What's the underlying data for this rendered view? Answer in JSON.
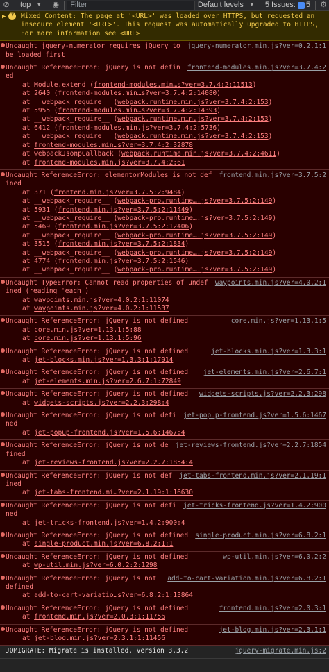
{
  "toolbar": {
    "context": "top",
    "filter_placeholder": "Filter",
    "levels": "Default levels",
    "issues_label": "5 Issues:",
    "issues_count": "5"
  },
  "messages": [
    {
      "level": "warn",
      "badge": "7",
      "text": "Mixed Content: The page at '<URL>' was loaded over HTTPS, but requested an insecure element '<URL>'. This request was automatically upgraded to HTTPS, For more information see <URL>",
      "source": "",
      "frames": []
    },
    {
      "level": "error",
      "text": "Uncaught jquery-numerator requires jQuery to be loaded first",
      "source": "jquery-numerator.min.js?ver=0.2.1:1",
      "frames": []
    },
    {
      "level": "error",
      "text": "Uncaught ReferenceError: jQuery is not defined",
      "source": "frontend-modules.min.js?ver=3.7.4:2",
      "frames": [
        {
          "pre": "at Module.extend (",
          "link": "frontend-modules.min…s?ver=3.7.4:2:11513",
          "post": ")"
        },
        {
          "pre": "at 2640 (",
          "link": "frontend-modules.min…s?ver=3.7.4:2:14080",
          "post": ")"
        },
        {
          "pre": "at __webpack_require__ (",
          "link": "webpack.runtime.min.js?ver=3.7.4:2:153",
          "post": ")"
        },
        {
          "pre": "at 5955 (",
          "link": "frontend-modules.min…s?ver=3.7.4:2:14393",
          "post": ")"
        },
        {
          "pre": "at __webpack_require__ (",
          "link": "webpack.runtime.min.js?ver=3.7.4:2:153",
          "post": ")"
        },
        {
          "pre": "at 6412 (",
          "link": "frontend-modules.min.js?ver=3.7.4:2:5736",
          "post": ")"
        },
        {
          "pre": "at __webpack_require__ (",
          "link": "webpack.runtime.min.js?ver=3.7.4:2:153",
          "post": ")"
        },
        {
          "pre": "at ",
          "link": "frontend-modules.min…s?ver=3.7.4:2:32878",
          "post": ""
        },
        {
          "pre": "at webpackJsonpCallback (",
          "link": "webpack.runtime.min.js?ver=3.7.4:2:4611",
          "post": ")"
        },
        {
          "pre": "at ",
          "link": "frontend-modules.min.js?ver=3.7.4:2:61",
          "post": ""
        }
      ]
    },
    {
      "level": "error",
      "text": "Uncaught ReferenceError: elementorModules is not defined",
      "source": "frontend.min.js?ver=3.7.5:2",
      "frames": [
        {
          "pre": "at 371 (",
          "link": "frontend.min.js?ver=3.7.5:2:9484",
          "post": ")"
        },
        {
          "pre": "at __webpack_require__ (",
          "link": "webpack-pro.runtime….js?ver=3.7.5:2:149",
          "post": ")"
        },
        {
          "pre": "at 5931 (",
          "link": "frontend.min.js?ver=3.7.5:2:11449",
          "post": ")"
        },
        {
          "pre": "at __webpack_require__ (",
          "link": "webpack-pro.runtime….js?ver=3.7.5:2:149",
          "post": ")"
        },
        {
          "pre": "at 5469 (",
          "link": "frontend.min.js?ver=3.7.5:2:12406",
          "post": ")"
        },
        {
          "pre": "at __webpack_require__ (",
          "link": "webpack-pro.runtime….js?ver=3.7.5:2:149",
          "post": ")"
        },
        {
          "pre": "at 3515 (",
          "link": "frontend.min.js?ver=3.7.5:2:1834",
          "post": ")"
        },
        {
          "pre": "at __webpack_require__ (",
          "link": "webpack-pro.runtime….js?ver=3.7.5:2:149",
          "post": ")"
        },
        {
          "pre": "at 4774 (",
          "link": "frontend.min.js?ver=3.7.5:2:1546",
          "post": ")"
        },
        {
          "pre": "at __webpack_require__ (",
          "link": "webpack-pro.runtime….js?ver=3.7.5:2:149",
          "post": ")"
        }
      ]
    },
    {
      "level": "error",
      "text": "Uncaught TypeError: Cannot read properties of undefined (reading 'each')",
      "source": "waypoints.min.js?ver=4.0.2:1",
      "frames": [
        {
          "pre": "at ",
          "link": "waypoints.min.js?ver=4.0.2:1:11074",
          "post": ""
        },
        {
          "pre": "at ",
          "link": "waypoints.min.js?ver=4.0.2:1:11537",
          "post": ""
        }
      ]
    },
    {
      "level": "error",
      "text": "Uncaught ReferenceError: jQuery is not defined",
      "source": "core.min.js?ver=1.13.1:5",
      "frames": [
        {
          "pre": "at ",
          "link": "core.min.js?ver=1.13.1:5:88",
          "post": ""
        },
        {
          "pre": "at ",
          "link": "core.min.js?ver=1.13.1:5:96",
          "post": ""
        }
      ]
    },
    {
      "level": "error",
      "text": "Uncaught ReferenceError: jQuery is not defined",
      "source": "jet-blocks.min.js?ver=1.3.3:1",
      "frames": [
        {
          "pre": "at ",
          "link": "jet-blocks.min.js?ver=1.3.3:1:17914",
          "post": ""
        }
      ]
    },
    {
      "level": "error",
      "text": "Uncaught ReferenceError: jQuery is not defined",
      "source": "jet-elements.min.js?ver=2.6.7:1",
      "frames": [
        {
          "pre": "at ",
          "link": "jet-elements.min.js?ver=2.6.7:1:72849",
          "post": ""
        }
      ]
    },
    {
      "level": "error",
      "text": "Uncaught ReferenceError: jQuery is not defined",
      "source": "widgets-scripts.js?ver=2.2.3:298",
      "frames": [
        {
          "pre": "at ",
          "link": "widgets-scripts.js?ver=2.2.3:298:4",
          "post": ""
        }
      ]
    },
    {
      "level": "error",
      "text": "Uncaught ReferenceError: jQuery is not defined",
      "source": "jet-popup-frontend.js?ver=1.5.6:1467",
      "frames": [
        {
          "pre": "at ",
          "link": "jet-popup-frontend.js?ver=1.5.6:1467:4",
          "post": ""
        }
      ]
    },
    {
      "level": "error",
      "text": "Uncaught ReferenceError: jQuery is not defined",
      "source": "jet-reviews-frontend.js?ver=2.2.7:1854",
      "frames": [
        {
          "pre": "at ",
          "link": "jet-reviews-frontend.js?ver=2.2.7:1854:4",
          "post": ""
        }
      ]
    },
    {
      "level": "error",
      "text": "Uncaught ReferenceError: jQuery is not defined",
      "source": "jet-tabs-frontend.min.js?ver=2.1.19:1",
      "frames": [
        {
          "pre": "at ",
          "link": "jet-tabs-frontend.mi…?ver=2.1.19:1:16630",
          "post": ""
        }
      ]
    },
    {
      "level": "error",
      "text": "Uncaught ReferenceError: jQuery is not defined",
      "source": "jet-tricks-frontend.js?ver=1.4.2:900",
      "frames": [
        {
          "pre": "at ",
          "link": "jet-tricks-frontend.js?ver=1.4.2:900:4",
          "post": ""
        }
      ]
    },
    {
      "level": "error",
      "text": "Uncaught ReferenceError: jQuery is not defined",
      "source": "single-product.min.js?ver=6.8.2:1",
      "frames": [
        {
          "pre": "at ",
          "link": "single-product.min.js?ver=6.8.2:1:1",
          "post": ""
        }
      ]
    },
    {
      "level": "error",
      "text": "Uncaught ReferenceError: jQuery is not defined",
      "source": "wp-util.min.js?ver=6.0.2:2",
      "frames": [
        {
          "pre": "at ",
          "link": "wp-util.min.js?ver=6.0.2:2:1298",
          "post": ""
        }
      ]
    },
    {
      "level": "error",
      "text": "Uncaught ReferenceError: jQuery is not defined",
      "source": "add-to-cart-variation.min.js?ver=6.8.2:1",
      "frames": [
        {
          "pre": "at ",
          "link": "add-to-cart-variatio…s?ver=6.8.2:1:13864",
          "post": ""
        }
      ]
    },
    {
      "level": "error",
      "text": "Uncaught ReferenceError: jQuery is not defined",
      "source": "frontend.min.js?ver=2.0.3:1",
      "frames": [
        {
          "pre": "at ",
          "link": "frontend.min.js?ver=2.0.3:1:11756",
          "post": ""
        }
      ]
    },
    {
      "level": "error",
      "text": "Uncaught ReferenceError: jQuery is not defined",
      "source": "jet-blog.min.js?ver=2.3.1:1",
      "frames": [
        {
          "pre": "at ",
          "link": "jet-blog.min.js?ver=2.3.1:1:11456",
          "post": ""
        }
      ]
    },
    {
      "level": "info",
      "text": "JQMIGRATE: Migrate is installed, version 3.3.2",
      "source": "jquery-migrate.min.js:2",
      "frames": []
    }
  ]
}
